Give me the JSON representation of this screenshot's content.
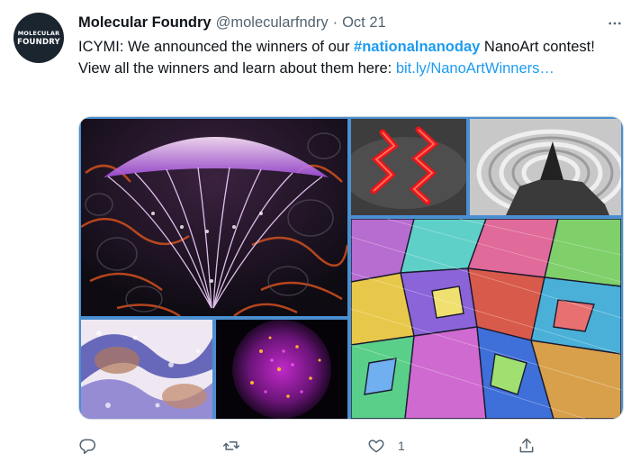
{
  "avatar": {
    "line1": "MOLECULAR",
    "line2": "FOUNDRY"
  },
  "tweet": {
    "author_name": "Molecular Foundry",
    "handle": "@molecularfndry",
    "separator": "·",
    "date": "Oct 21",
    "text_before": "ICYMI: We announced the winners of our ",
    "hashtag": "#nationalnanoday",
    "text_after": " NanoArt contest!  View all the winners and learn about them here: ",
    "link": "bit.ly/NanoArtWinners…"
  },
  "actions": {
    "reply_count": "",
    "retweet_count": "",
    "like_count": "1"
  },
  "colors": {
    "accent": "#1d9bf0",
    "secondary_text": "#536471",
    "media_border": "#4a8fd0"
  },
  "icons": [
    "more-icon",
    "reply-icon",
    "retweet-icon",
    "like-icon",
    "share-icon"
  ]
}
